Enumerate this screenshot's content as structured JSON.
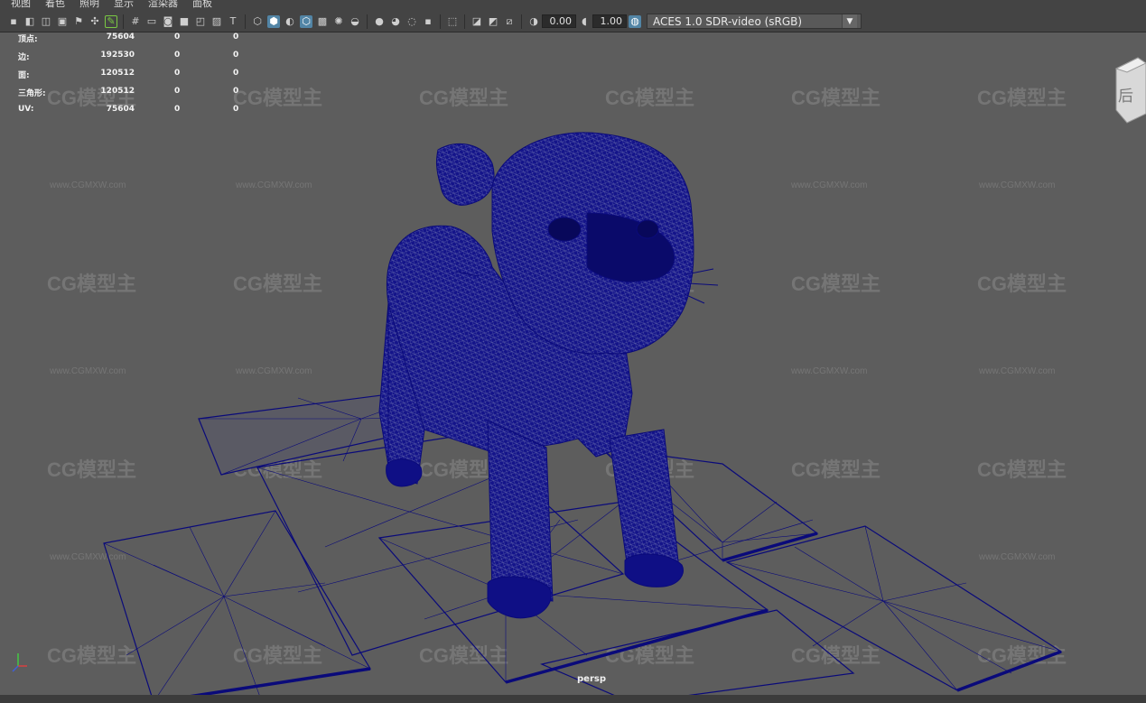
{
  "menu": [
    "视图",
    "着色",
    "照明",
    "显示",
    "渲染器",
    "面板"
  ],
  "toolbar": {
    "exposure_value": "0.00",
    "gamma_value": "1.00",
    "colorspace": "ACES 1.0 SDR-video (sRGB)"
  },
  "hud": {
    "rows": [
      {
        "label": "顶点:",
        "v1": "75604",
        "v2": "0",
        "v3": "0"
      },
      {
        "label": "边:",
        "v1": "192530",
        "v2": "0",
        "v3": "0"
      },
      {
        "label": "面:",
        "v1": "120512",
        "v2": "0",
        "v3": "0"
      },
      {
        "label": "三角形:",
        "v1": "120512",
        "v2": "0",
        "v3": "0"
      },
      {
        "label": "UV:",
        "v1": "75604",
        "v2": "0",
        "v3": "0"
      }
    ]
  },
  "viewport": {
    "camera_label": "persp",
    "wire_color": "#0a0a7a",
    "background_color": "#5d5d5d",
    "viewcube_face": "后",
    "watermark_logo": "CG模型主",
    "watermark_url": "www.CGMXW.com"
  }
}
